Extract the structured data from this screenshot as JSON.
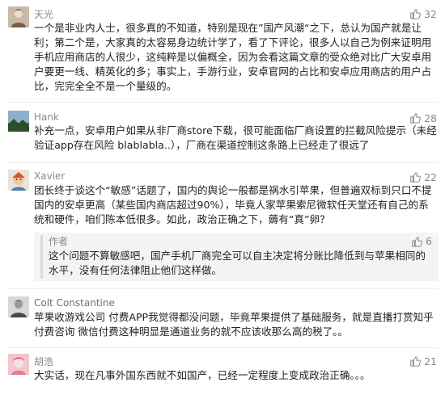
{
  "accent": "#8a8a8a",
  "comments": [
    {
      "user": "天光",
      "avatar_icon": "user-avatar-icon",
      "likes": "32",
      "text": "一个是非业内人士，很多真的不知道，特别是现在”国产风潮“之下，总认为国产就是让利；第二个是，大家真的太容易身边统计学了，看了下评论，很多人以自己为例来证明用手机应用商店的人很少，这纯粹是以偏概全，因为会看这篇文章的受众绝对比广大安卓用户要更一线、精英化的多；事实上，手游行业，安卓官网的占比和安卓应用商店的用户占比，完完全全不是一个量级的。"
    },
    {
      "user": "Hank",
      "avatar_icon": "landscape-avatar-icon",
      "likes": "28",
      "text": "补充一点，安卓用户如果从非厂商store下载，很可能面临厂商设置的拦截风险提示（未经验证app存在风险 blablabla..），厂商在渠道控制这条路上已经走了很远了"
    },
    {
      "user": "Xavier",
      "avatar_icon": "cartoon-avatar-icon",
      "likes": "22",
      "text": "团长终于谈这个“敏感”话题了，国内的舆论一般都是祸水引苹果，但普遍双标到只口不提国内的安卓更高（某些国内商店超过90%），毕竟人家苹果索尼微软任天堂还有自己的系统和硬件，咱们陈本低很多。如此，政治正确之下，薅有“真”卵？",
      "reply": {
        "user": "作者",
        "likes": "6",
        "text": "这个问题不算敏感吧，国产手机厂商完全可以自主决定将分账比降低到与苹果相同的水平，没有任何法律阻止他们这样做。"
      }
    },
    {
      "user": "Colt Constantine",
      "avatar_icon": "bw-portrait-avatar-icon",
      "likes": "",
      "text": "苹果收游戏公司 付费APP我觉得都没问题，毕竟苹果提供了基础服务，就是直播打赏知乎付费咨询 微信付费这种明显是通道业务的就不应该收那么高的税了。。"
    },
    {
      "user": "胡浩",
      "avatar_icon": "pink-avatar-icon",
      "likes": "21",
      "text": "大实话，现在凡事外国东西就不如国产，已经一定程度上变成政治正确。。。"
    }
  ]
}
